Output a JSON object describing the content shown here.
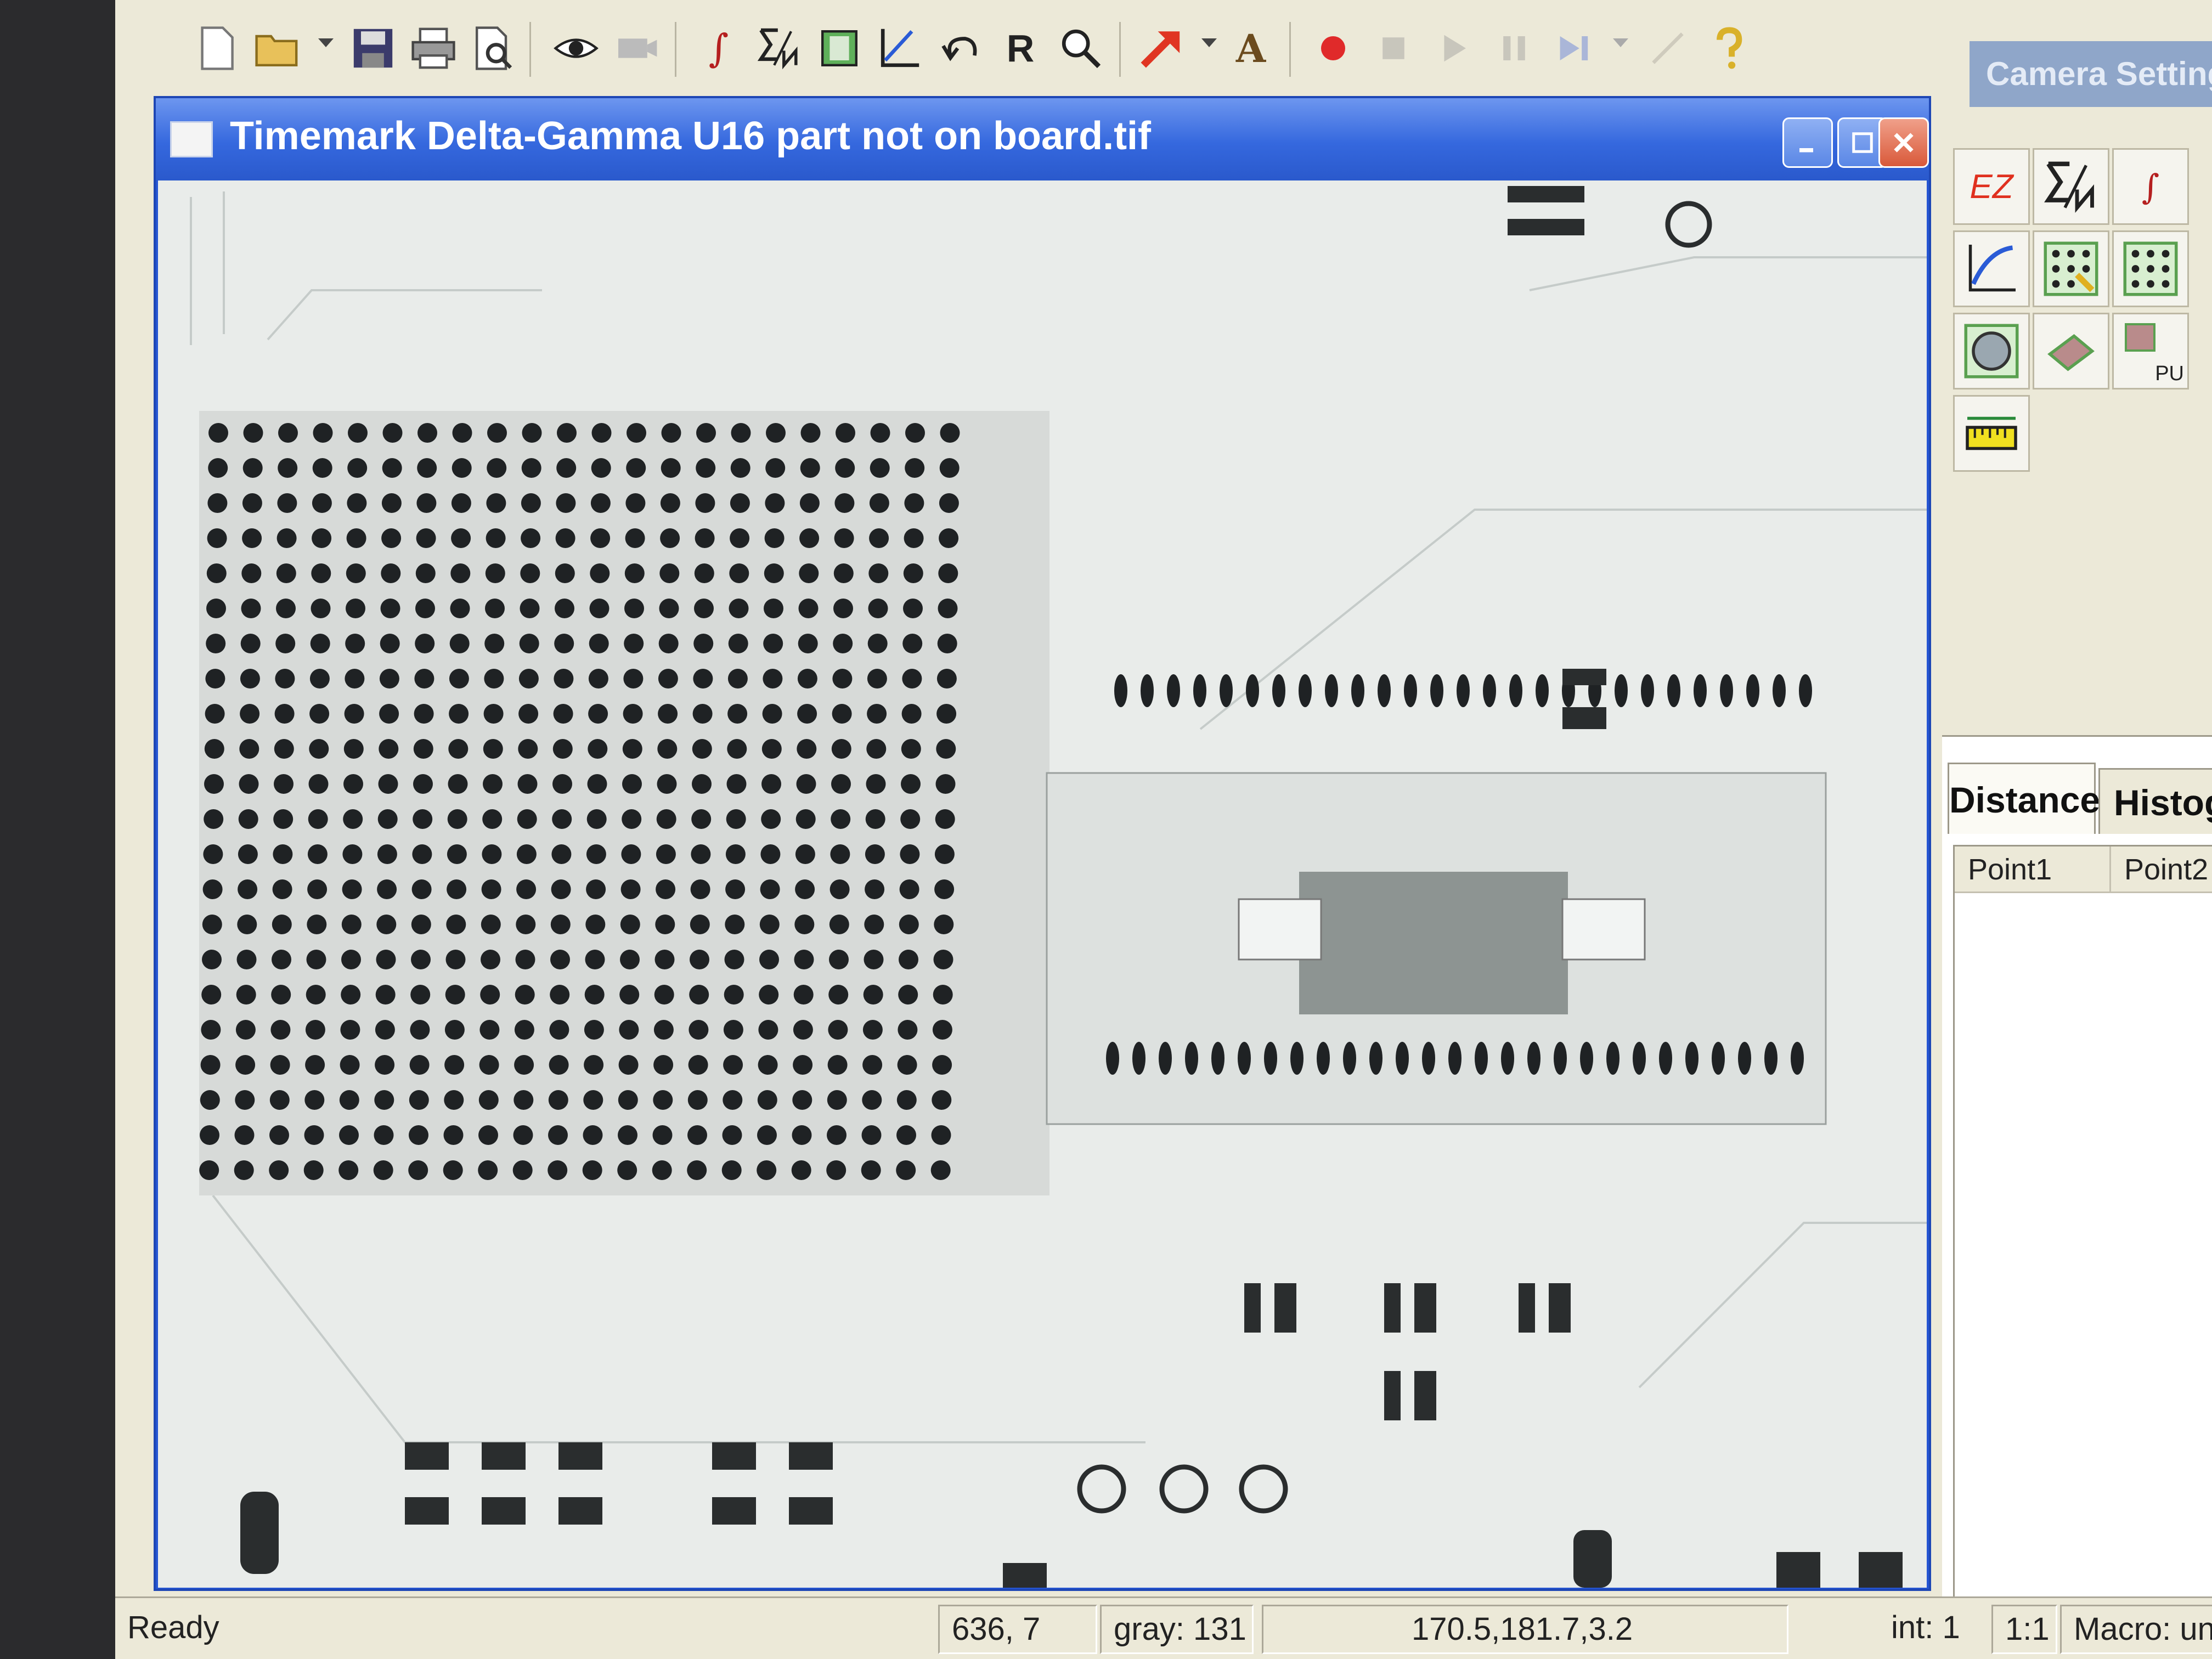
{
  "toolbar": {
    "items": [
      "new-file-icon",
      "open-folder-icon",
      "save-icon",
      "print-icon",
      "print-preview-icon",
      "eye-icon",
      "camera-icon",
      "integral-icon",
      "sigma-n-icon",
      "region-icon",
      "curve-icon",
      "undo-icon",
      "r-icon",
      "zoom-icon",
      "arrow-icon",
      "text-icon",
      "record-icon",
      "stop-icon",
      "play-icon",
      "pause-icon",
      "step-play-icon",
      "help-icon"
    ],
    "integral_symbol": "∫",
    "r_label": "R",
    "text_tool_label": "A",
    "camera_settings_label": "Camera Settings"
  },
  "image_window": {
    "title": "Timemark Delta-Gamma U16 part not on board.tif"
  },
  "right_panel": {
    "ez_label": "EZ",
    "integral_symbol": "∫",
    "pu_label": "PU",
    "tabs": [
      "Distance",
      "Histogram"
    ],
    "table_headers": [
      "Point1",
      "Point2"
    ]
  },
  "statusbar": {
    "ready": "Ready",
    "coords": "636, 7",
    "gray": "gray: 131",
    "measure": "170.5,181.7,3.2",
    "int": "int: 1",
    "zoom": "1:1",
    "macro": "Macro: unde"
  },
  "colors": {
    "title_bar": "#2a59cc",
    "record_red": "#e02a2a",
    "arrow_red": "#e03522",
    "ez_red": "#e0301e"
  }
}
